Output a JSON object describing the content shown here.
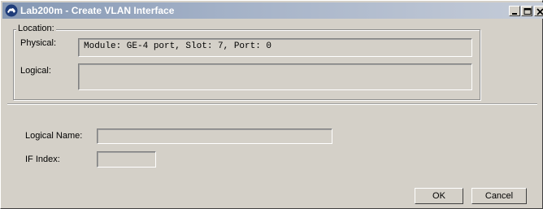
{
  "window": {
    "title": "Lab200m - Create VLAN Interface",
    "icon": "app-logo-icon"
  },
  "titlebar_buttons": [
    "minimize",
    "maximize",
    "close"
  ],
  "location": {
    "legend": "Location:",
    "physical_label": "Physical:",
    "physical_value": "Module: GE-4 port, Slot: 7, Port: 0",
    "logical_label": "Logical:",
    "logical_value": ""
  },
  "form": {
    "logical_name_label": "Logical Name:",
    "logical_name_value": "",
    "if_index_label": "IF Index:",
    "if_index_value": ""
  },
  "buttons": {
    "ok": "OK",
    "cancel": "Cancel"
  },
  "colors": {
    "face": "#d4d0c8",
    "titlebar_start": "#8497b3",
    "titlebar_end": "#c5ccd8",
    "title_text": "#ffffff"
  }
}
